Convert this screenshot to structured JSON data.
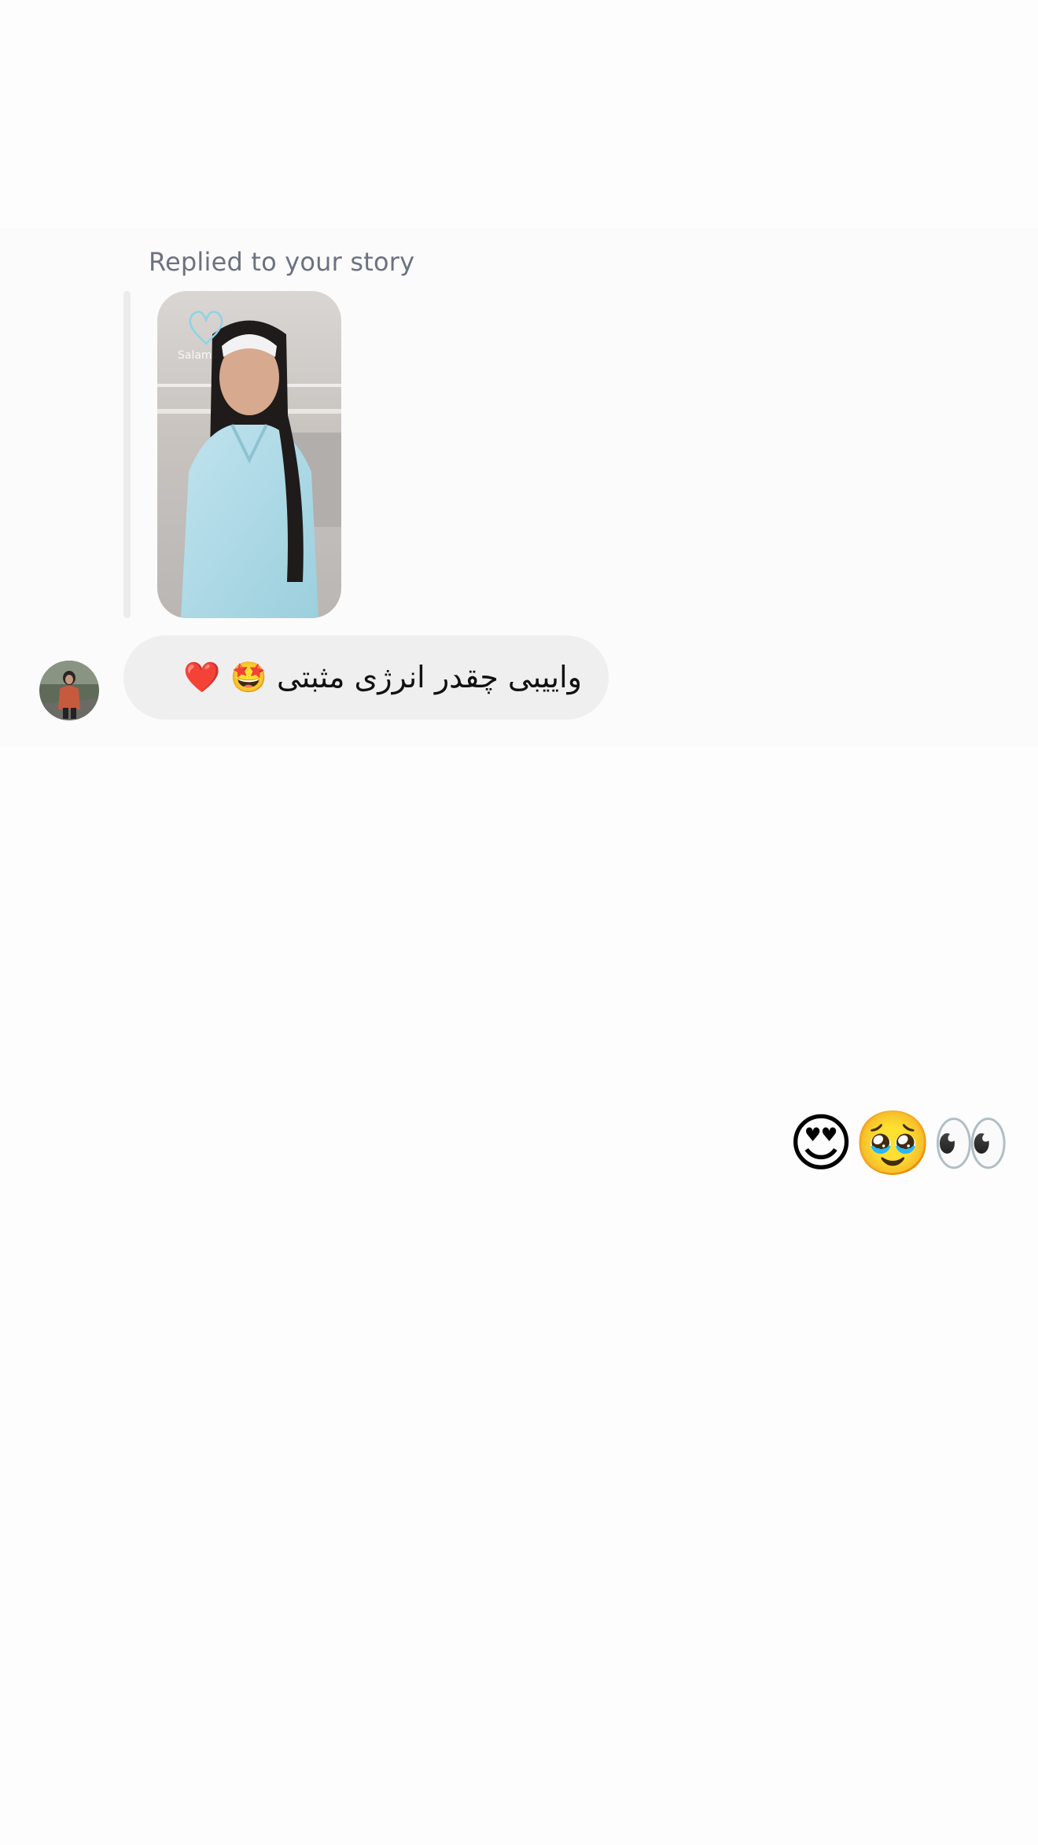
{
  "thread": {
    "reply_context": {
      "caption": "Replied to your story",
      "story_sticker_text": "Salam"
    },
    "incoming_message": {
      "text": "واییبی چقدر انرژی مثبتی 🤩 ❤️"
    },
    "outgoing_message": {
      "emoji_text": "😍🥹👀"
    }
  },
  "colors": {
    "caption_gray": "#6b7280",
    "bubble_gray": "#efefef",
    "reply_rule": "#ececec",
    "page_background": "#fdfdfd"
  }
}
